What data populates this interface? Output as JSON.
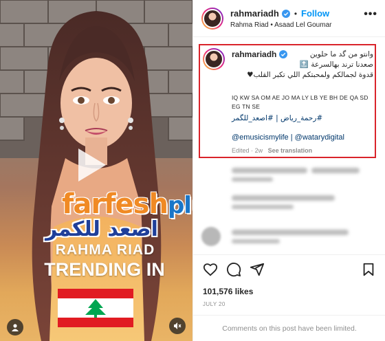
{
  "post": {
    "username": "rahmariadh",
    "follow_label": "Follow",
    "separator": "•",
    "more_label": "•••",
    "audio_line": "Rahma Riad • Asaad Lel Goumar"
  },
  "media": {
    "song_title_ar": "اصعد للكمر",
    "artist_overlay": "RAHMA RIAD",
    "trending_label": "TRENDING IN",
    "watermark_a": "farfesh",
    "watermark_b": "plus.com",
    "flag_country": "Lebanon"
  },
  "caption": {
    "username": "rahmariadh",
    "line1": "وانتو من گد ما حلوين",
    "line2": "صعدنا ترند بهالسرعة",
    "line2_emoji": "🔝",
    "line3": "قدوة لجمالكم ولمحبتكم اللي تكبر القلب♥",
    "countries": "IQ KW SA OM AE JO MA LY LB YE BH DE QA SD EG TN SE",
    "hashtags": "#رحمة_رياض | #اصعد_للگمر",
    "mentions": "@emusicismylife | @watarydigital",
    "edited": "Edited",
    "age": "2w",
    "see_translation": "See translation"
  },
  "engagement": {
    "likes": "101,576 likes",
    "date": "JULY 20",
    "comments_limited": "Comments on this post have been limited."
  },
  "colors": {
    "follow": "#0095f6",
    "link": "#00376b",
    "highlight_box": "#d9232a",
    "muted": "#8e8e8e",
    "verified": "#3897f0"
  },
  "icons": {
    "like": "heart-icon",
    "comment": "comment-icon",
    "share": "share-icon",
    "save": "bookmark-icon",
    "play": "play-icon",
    "tag": "user-tag-icon",
    "mute": "mute-icon"
  }
}
